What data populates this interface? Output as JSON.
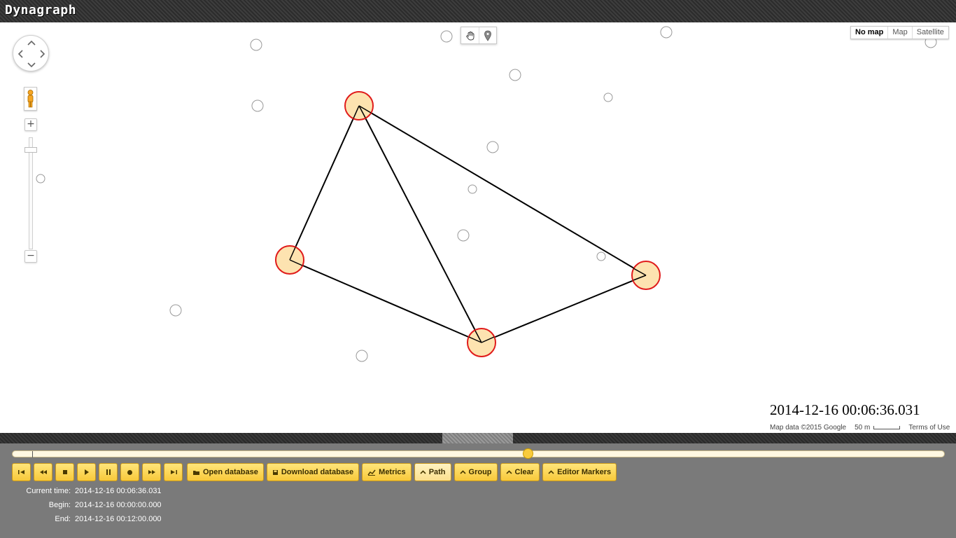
{
  "app": {
    "title": "Dynagraph"
  },
  "map": {
    "type_options": [
      "No map",
      "Map",
      "Satellite"
    ],
    "selected_type": "No map",
    "timestamp": "2014-12-16 00:06:36.031",
    "attribution": {
      "data": "Map data ©2015 Google",
      "scale": "50 m",
      "terms": "Terms of Use"
    },
    "tools": [
      "hand-icon",
      "marker-icon"
    ],
    "nav_icons": [
      "pan-control-icon",
      "pegman-icon",
      "zoom-in-icon",
      "zoom-out-icon"
    ],
    "graph": {
      "node_fill": "#fde3b0",
      "node_stroke": "#e01b1b",
      "edge_color": "#000000",
      "highlighted_nodes": 4,
      "edges": 5
    }
  },
  "playback": {
    "buttons": [
      "skip-to-start-icon",
      "step-back-icon",
      "stop-icon",
      "play-icon",
      "pause-icon",
      "record-icon",
      "step-forward-icon",
      "skip-to-end-icon"
    ],
    "open_database": "Open database",
    "download_database": "Download database",
    "metrics": "Metrics",
    "path": "Path",
    "group": "Group",
    "clear": "Clear",
    "editor_markers": "Editor Markers",
    "progress_fraction": 0.553,
    "accent": "#f9cb3c"
  },
  "info": {
    "current_label": "Current time:",
    "current_value": "2014-12-16 00:06:36.031",
    "begin_label": "Begin:",
    "begin_value": "2014-12-16 00:00:00.000",
    "end_label": "End:",
    "end_value": "2014-12-16 00:12:00.000"
  }
}
